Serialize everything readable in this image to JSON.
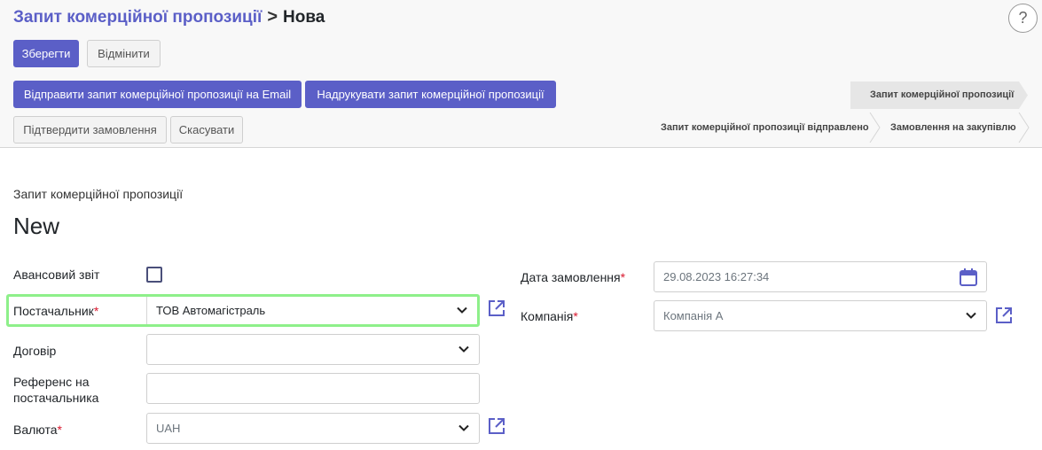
{
  "breadcrumb": {
    "parent": "Запит комерційної пропозиції",
    "separator": ">",
    "current": "Нова"
  },
  "help_label": "?",
  "actions": {
    "save_label": "Зберегти",
    "discard_label": "Відмінити"
  },
  "header_buttons": {
    "send_email_label": "Відправити запит комерційної пропозиції на Email",
    "print_label": "Надрукувати запит комерційної пропозиції",
    "confirm_label": "Підтвердити замовлення",
    "cancel_label": "Скасувати"
  },
  "statusbar": {
    "active_step": "Запит комерційної пропозиції",
    "steps": [
      "Запит комерційної пропозиції відправлено",
      "Замовлення на закупівлю"
    ]
  },
  "form": {
    "doc_label": "Запит комерційної пропозиції",
    "doc_name": "New",
    "advance_report": {
      "label": "Авансовий звіт",
      "checked": false
    },
    "vendor": {
      "label": "Постачальник",
      "required_mark": "*",
      "value": "ТОВ Автомагістраль"
    },
    "contract": {
      "label": "Договір",
      "value": ""
    },
    "vendor_reference": {
      "label": "Референс на постачальника",
      "value": ""
    },
    "currency": {
      "label": "Валюта",
      "required_mark": "*",
      "value": "UAH"
    },
    "order_date": {
      "label": "Дата замовлення",
      "required_mark": "*",
      "value": "29.08.2023 16:27:34"
    },
    "company": {
      "label": "Компанія",
      "required_mark": "*",
      "value": "Компанія А"
    }
  },
  "colors": {
    "accent": "#5b5fc7",
    "highlight": "#8ef08a",
    "required": "#d9182e"
  },
  "icons": {
    "caret": "chevron-down-icon",
    "external_link": "external-link-icon",
    "calendar": "calendar-icon"
  }
}
